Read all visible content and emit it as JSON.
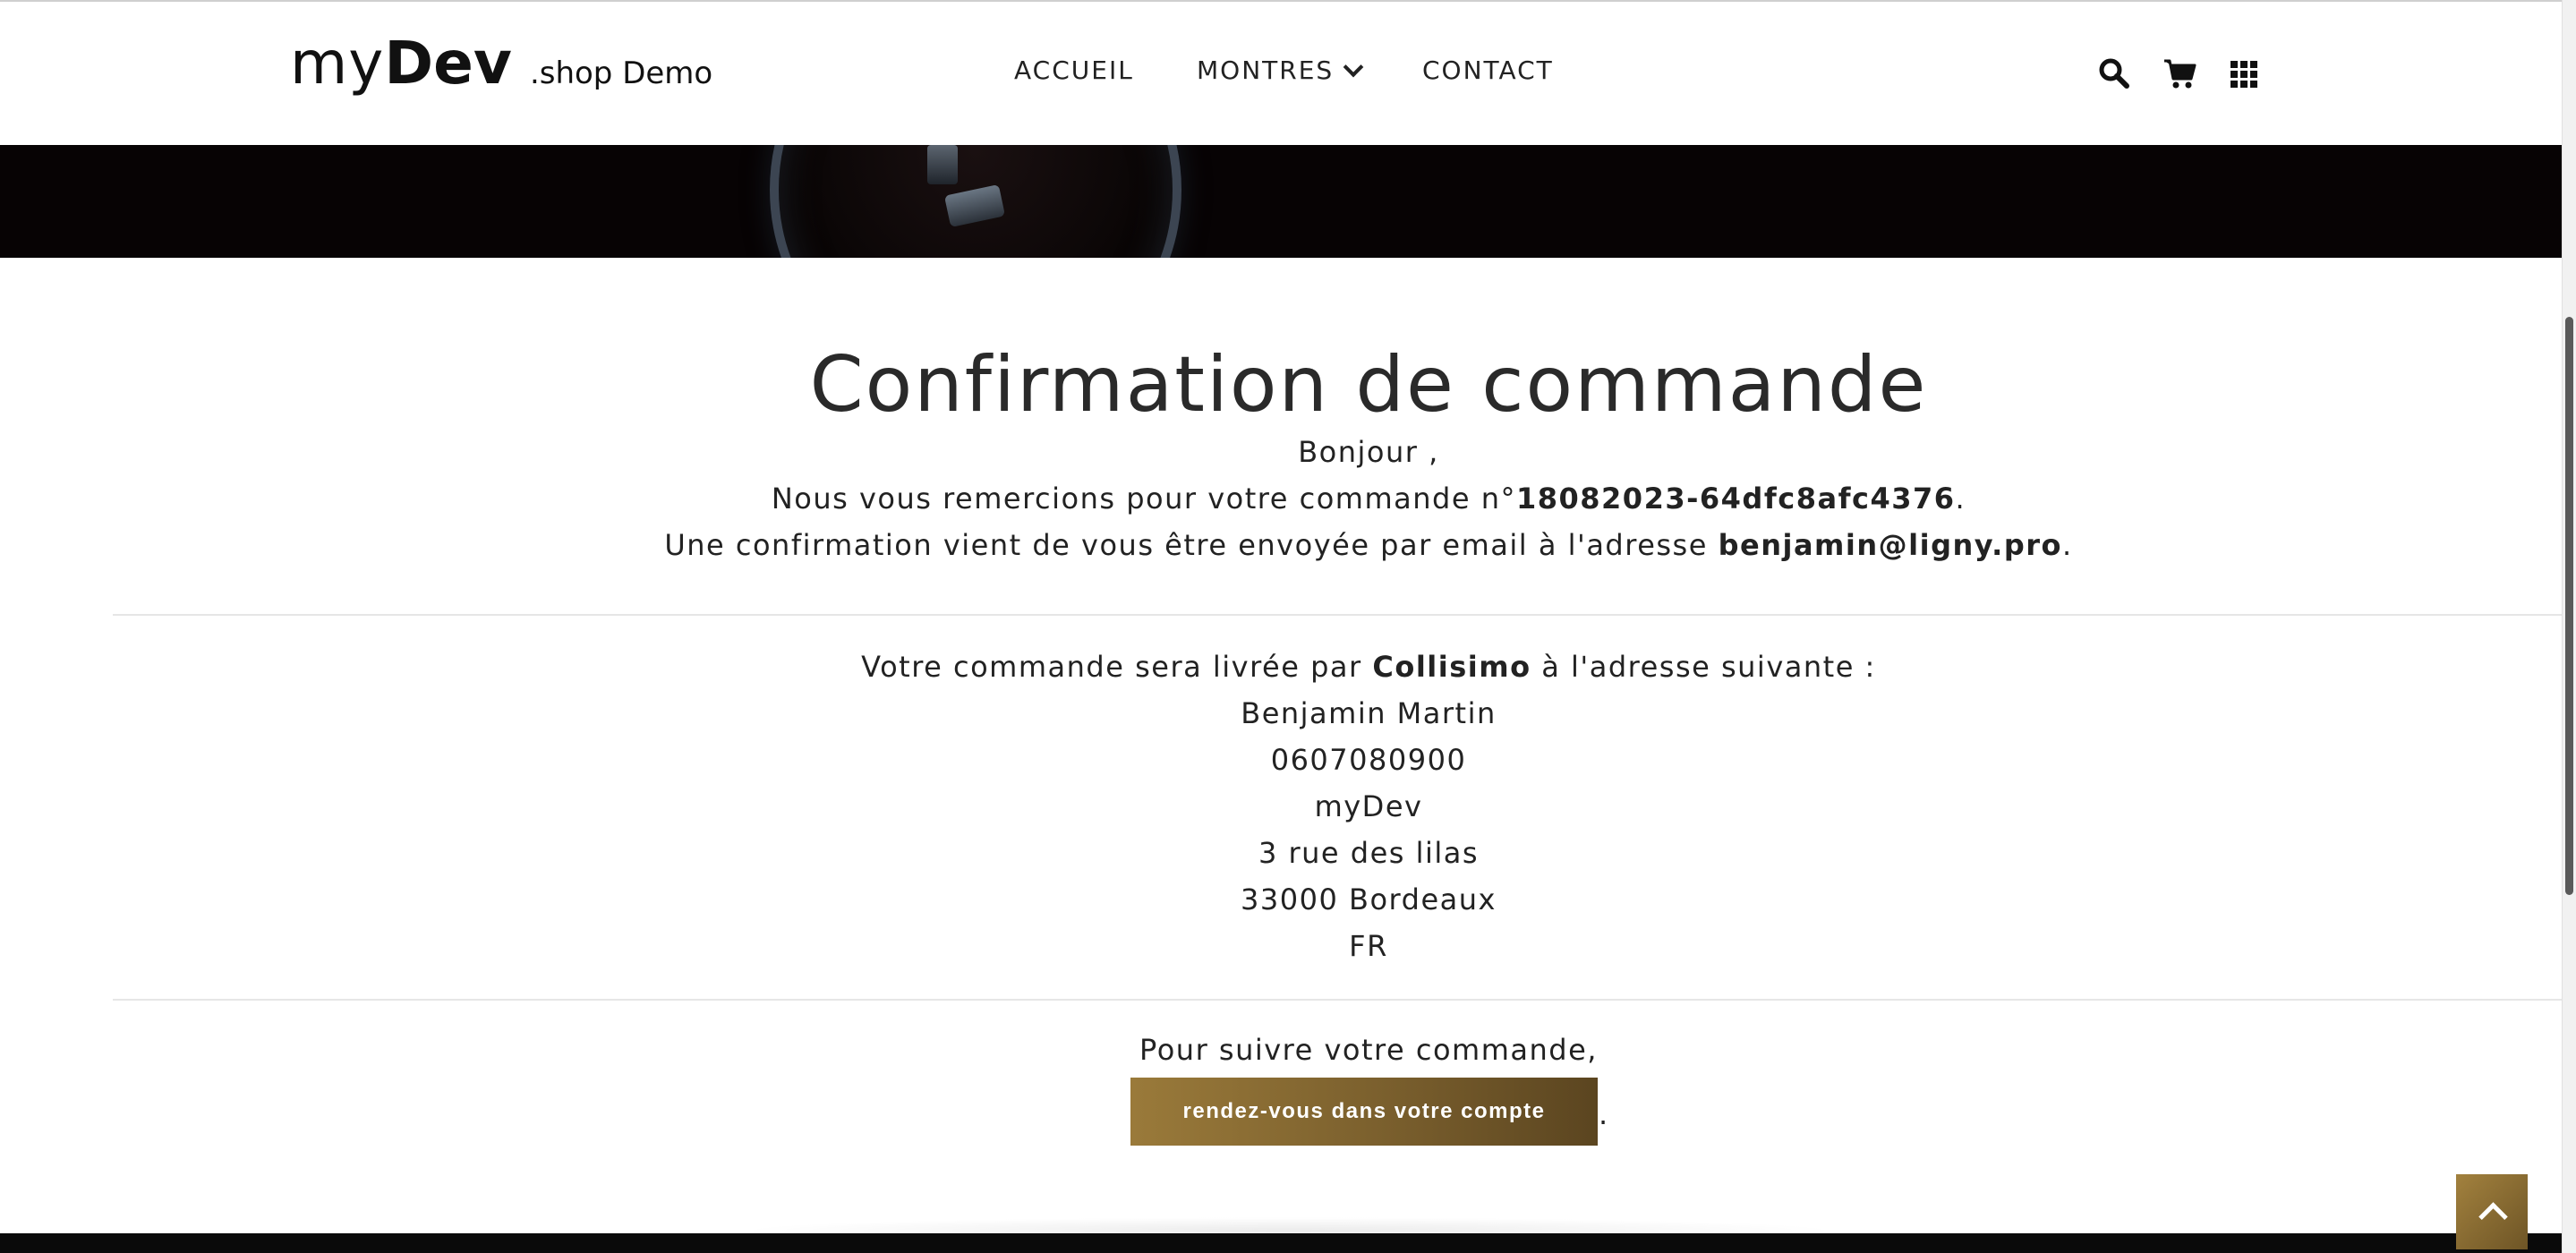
{
  "header": {
    "logo": {
      "my": "my",
      "dev": "Dev",
      "sub": ".shop Demo"
    },
    "nav": [
      {
        "label": "ACCUEIL"
      },
      {
        "label": "MONTRES"
      },
      {
        "label": "CONTACT"
      }
    ],
    "icons": [
      "search-icon",
      "cart-icon",
      "grid-menu-icon"
    ]
  },
  "confirmation": {
    "title": "Confirmation de commande",
    "greeting": "Bonjour ,",
    "thanks_prefix": "Nous vous remercions pour votre commande n°",
    "order_number": "18082023-64dfc8afc4376",
    "thanks_suffix": ".",
    "email_prefix": "Une confirmation vient de vous être envoyée par email à l'adresse ",
    "email": "benjamin@ligny.pro",
    "email_suffix": "."
  },
  "shipping": {
    "intro_prefix": "Votre commande sera livrée par ",
    "carrier": "Collisimo",
    "intro_suffix": " à l'adresse suivante :",
    "name": "Benjamin Martin",
    "phone": "0607080900",
    "company": "myDev",
    "street": "3 rue des lilas",
    "city": "33000 Bordeaux",
    "country": "FR"
  },
  "tracking": {
    "text": "Pour suivre votre commande,",
    "button_label": "rendez-vous dans votre compte",
    "suffix": "."
  },
  "colors": {
    "accent_gold": "#8a6d33",
    "banner_dark": "#070304",
    "footer_dark": "#0a0a0a"
  }
}
